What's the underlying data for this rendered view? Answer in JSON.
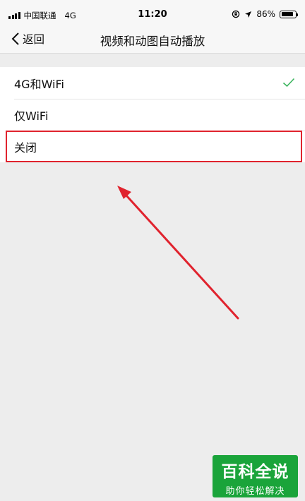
{
  "status_bar": {
    "carrier": "中国联通",
    "network": "4G",
    "time": "11:20",
    "battery": "86%",
    "battery_level": 0.86
  },
  "nav": {
    "back_label": "返回",
    "title": "视频和动图自动播放"
  },
  "options": [
    {
      "label": "4G和WiFi",
      "selected": true
    },
    {
      "label": "仅WiFi",
      "selected": false
    },
    {
      "label": "关闭",
      "selected": false
    }
  ],
  "colors": {
    "checkmark": "#3cb55f",
    "annotation": "#e0232e",
    "watermark_bg": "#1aa43a"
  },
  "watermark": {
    "main": "百科全说",
    "sub": "助你轻松解决"
  }
}
